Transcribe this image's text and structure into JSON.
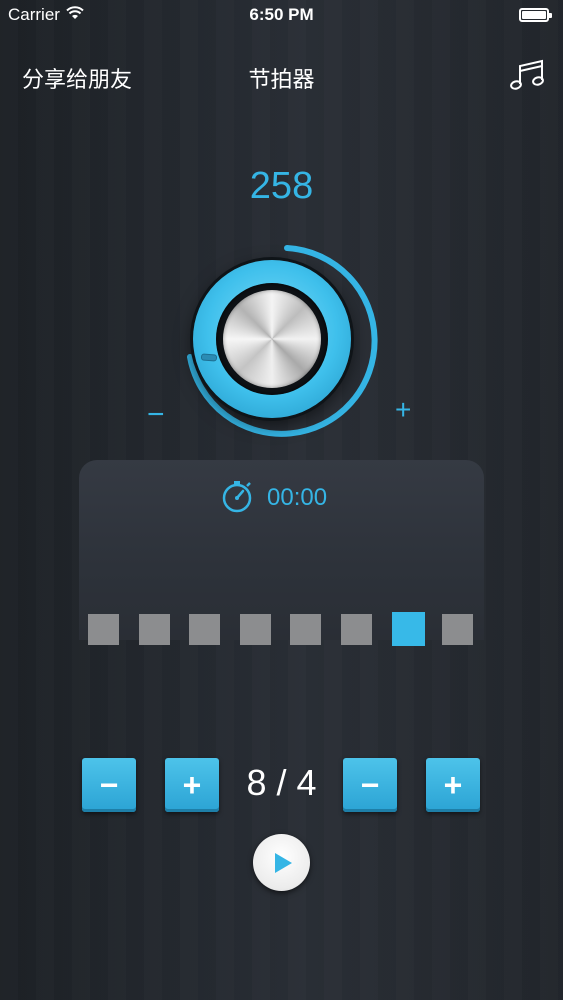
{
  "status_bar": {
    "carrier": "Carrier",
    "time": "6:50 PM"
  },
  "nav": {
    "share_label": "分享给朋友",
    "title": "节拍器",
    "music_icon": "music-note-icon"
  },
  "tempo": {
    "bpm": "258",
    "minus_label": "−",
    "plus_label": "+"
  },
  "timer": {
    "icon": "stopwatch-icon",
    "value": "00:00"
  },
  "beats": {
    "count": 8,
    "active_index": 6
  },
  "controls": {
    "beats_minus": "−",
    "beats_plus": "+",
    "time_signature": "8 / 4",
    "note_minus": "−",
    "note_plus": "+"
  },
  "play": {
    "icon": "play-icon"
  },
  "colors": {
    "accent": "#35b5e5",
    "beat_inactive": "#8c8d8f",
    "beat_active": "#37b9e8"
  }
}
